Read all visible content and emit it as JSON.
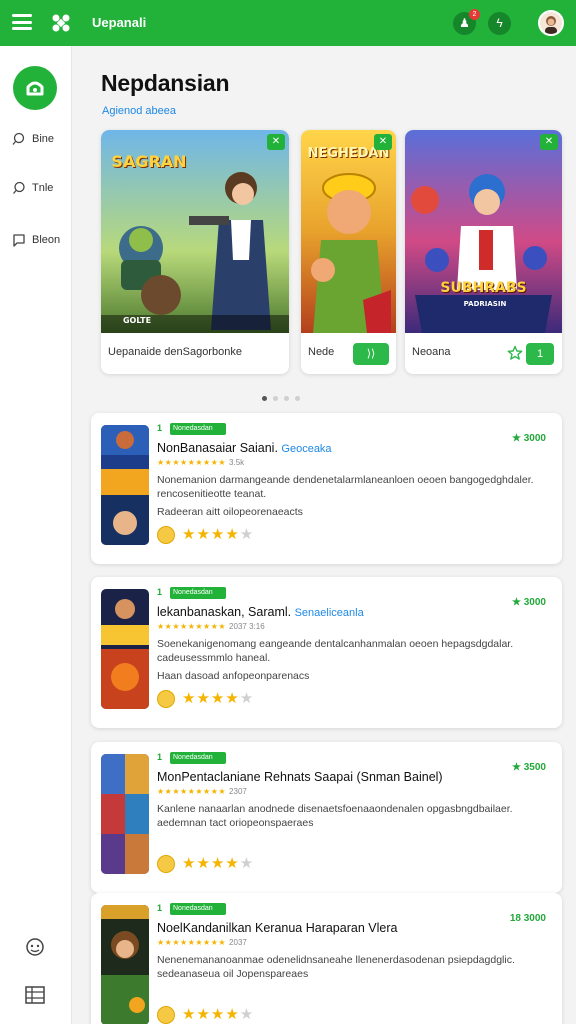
{
  "app": {
    "title": "Uepanali"
  },
  "topbar": {
    "notif_badge": "2",
    "icon_a": "notification-icon",
    "icon_b": "activity-icon"
  },
  "sidebar": {
    "items": [
      {
        "label": "Bine",
        "icon": "search-icon"
      },
      {
        "label": "Tnle",
        "icon": "chat-icon"
      },
      {
        "label": "Bleon",
        "icon": "message-icon"
      }
    ]
  },
  "main": {
    "title": "Nepdansian",
    "section_link": "Agienod abeea"
  },
  "featured": [
    {
      "art_title": "SAGRAN",
      "art_subtitle": "GOLTE",
      "caption": "Uepanaide denSagorbonke",
      "button": ""
    },
    {
      "art_title": "NEGHEDAN",
      "caption": "Nede",
      "button": ""
    },
    {
      "art_title": "SUBHRABS",
      "art_subtitle": "PADRIASIN",
      "caption": "Neoana",
      "button": "1"
    }
  ],
  "carousel": {
    "count": 4,
    "active": 0
  },
  "list": [
    {
      "rank": "1",
      "tag": "Nonedasdan",
      "price": "3000",
      "name": "NonBanasaiar Saiani.",
      "dev": "Geoceaka",
      "count": "3.5k",
      "desc": "Nonemanion darmangeande dendenetalarmlaneanloen oeoen bangogedghdaler. rencosenitieotte teanat.",
      "more": "Radeeran aitt oilopeorenaeacts",
      "rating": 4
    },
    {
      "rank": "1",
      "tag": "Nonedasdan",
      "price": "3000",
      "name": "lekanbanaskan, Saraml.",
      "dev": "Senaeliceanla",
      "count": "2037 3:16",
      "desc": "Soenekanigenomang eangeande dentalcanhanmalan oeoen hepagsdgdalar. cadeusessmmlo haneal.",
      "more": "Haan dasoad anfopeonparenacs",
      "rating": 4
    },
    {
      "rank": "1",
      "tag": "Nonedasdan",
      "price": "3500",
      "name": "MonPentaclaniane Rehnats Saapai (Snman Bainel)",
      "dev": "",
      "count": "2307",
      "desc": "Kanlene nanaarlan anodnede disenaetsfoenaaondenalen opgasbngdbailaer. aedemnan tact oriopeonspaeraes",
      "more": "",
      "rating": 4
    },
    {
      "rank": "1",
      "tag": "Nonedasdan",
      "price": "18 3000",
      "name": "NoelKandanilkan Keranua Haraparan Vlera",
      "dev": "",
      "count": "2037",
      "desc": "Nenenemananoanmae odenelidnsaneahe llenenerdasodenan psiepdagdglic. sedeanaseua oil Jopenspareaes",
      "more": "",
      "rating": 4
    }
  ],
  "colors": {
    "brand": "#22b23a",
    "accent": "#1e88e5",
    "star": "#f4b400"
  }
}
